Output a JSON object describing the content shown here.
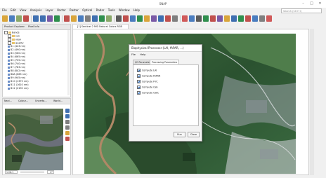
{
  "window": {
    "title": "SNAP",
    "buttons": {
      "minimize": "–",
      "maximize": "□",
      "close": "×"
    }
  },
  "menu": [
    "File",
    "Edit",
    "View",
    "Analysis",
    "Layer",
    "Vector",
    "Raster",
    "Optical",
    "Radar",
    "Tools",
    "Window",
    "Help"
  ],
  "search": {
    "placeholder": "Search (Ctrl+I)"
  },
  "product_explorer": {
    "tabs": [
      "Product Explorer",
      "Pixel Info"
    ],
    "tree": [
      {
        "label": "Bands",
        "level": 0,
        "kind": "folder"
      },
      {
        "label": "sun",
        "level": 1,
        "kind": "folder"
      },
      {
        "label": "view",
        "level": 1,
        "kind": "folder"
      },
      {
        "label": "quality",
        "level": 1,
        "kind": "folder"
      },
      {
        "label": "B1 (443 nm)",
        "level": 1,
        "kind": "band"
      },
      {
        "label": "B2 (490 nm)",
        "level": 1,
        "kind": "band"
      },
      {
        "label": "B3 (560 nm)",
        "level": 1,
        "kind": "band"
      },
      {
        "label": "B4 (665 nm)",
        "level": 1,
        "kind": "band"
      },
      {
        "label": "B5 (705 nm)",
        "level": 1,
        "kind": "band"
      },
      {
        "label": "B6 (740 nm)",
        "level": 1,
        "kind": "band"
      },
      {
        "label": "B7 (783 nm)",
        "level": 1,
        "kind": "band"
      },
      {
        "label": "B8 (842 nm)",
        "level": 1,
        "kind": "band"
      },
      {
        "label": "B8A (865 nm)",
        "level": 1,
        "kind": "band"
      },
      {
        "label": "B9 (945 nm)",
        "level": 1,
        "kind": "band"
      },
      {
        "label": "B10 (1375 nm)",
        "level": 1,
        "kind": "band"
      },
      {
        "label": "B11 (1610 nm)",
        "level": 1,
        "kind": "band"
      },
      {
        "label": "B12 (2190 nm)",
        "level": 1,
        "kind": "band"
      }
    ]
  },
  "navigation": {
    "tabs": [
      "Navi...",
      "Colour...",
      "Uncerta...",
      "World..."
    ],
    "zoom_value": "1.26:1",
    "rotation_value": "0°"
  },
  "image_view": {
    "tab_label": "[1] Sentinel 2 MSI Natural Colors RGB"
  },
  "dialog": {
    "title": "Biophysical Processor (LAI, fAPAR, ...)",
    "menu": [
      "File",
      "Help"
    ],
    "tabs": [
      "I/O Parameters",
      "Processing Parameters"
    ],
    "active_tab": 1,
    "checkboxes": [
      {
        "label": "Compute LAI",
        "checked": true
      },
      {
        "label": "Compute FAPAR",
        "checked": true
      },
      {
        "label": "Compute FVC",
        "checked": true
      },
      {
        "label": "Compute Cab",
        "checked": true
      },
      {
        "label": "Compute CWC",
        "checked": true
      }
    ],
    "run_label": "Run",
    "close_label": "Close"
  },
  "colors": {
    "accent": "#1d5fb3",
    "folder": "#e9c46a",
    "band": "#6a8ec8",
    "vegetation": "#2f5a33"
  },
  "icons": [
    "menu-toolbar-icons",
    "checkbox-checked-icon",
    "zoom-in-icon",
    "zoom-out-icon",
    "pan-icon",
    "sync-icon"
  ]
}
